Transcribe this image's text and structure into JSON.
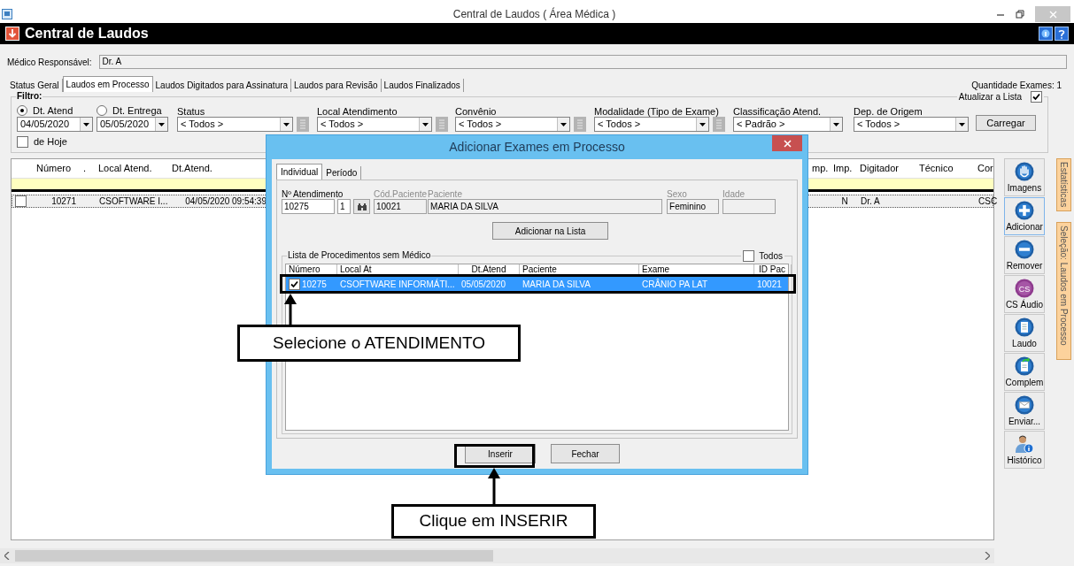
{
  "window": {
    "title": "Central de Laudos ( Área Médica )"
  },
  "app_header": {
    "title": "Central de Laudos"
  },
  "medico": {
    "label": "Médico Responsável:",
    "value": "Dr. A"
  },
  "tabs": [
    {
      "label": "Status Geral",
      "selected": false
    },
    {
      "label": "Laudos em Processo",
      "selected": true
    },
    {
      "label": "Laudos Digitados para Assinatura",
      "selected": false
    },
    {
      "label": "Laudos para Revisão",
      "selected": false
    },
    {
      "label": "Laudos Finalizados",
      "selected": false
    }
  ],
  "quantidade": "Quantidade Exames: 1",
  "filter": {
    "title": "Filtro:",
    "atualizar": {
      "label": "Atualizar a Lista",
      "checked": true
    },
    "date_modes": [
      {
        "label": "Dt. Atend",
        "selected": true,
        "value": "04/05/2020"
      },
      {
        "label": "Dt. Entrega",
        "selected": false,
        "value": "05/05/2020"
      }
    ],
    "de_hoje": {
      "label": "de Hoje",
      "checked": false
    },
    "dropdowns": [
      {
        "label": "Status",
        "value": "< Todos >",
        "lookup": true
      },
      {
        "label": "Local Atendimento",
        "value": "< Todos >",
        "lookup": true
      },
      {
        "label": "Convênio",
        "value": "< Todos >",
        "lookup": true
      },
      {
        "label": "Modalidade (Tipo de Exame)",
        "value": "< Todos >",
        "lookup": true
      },
      {
        "label": "Classificação Atend.",
        "value": "< Padrão >",
        "lookup": false
      },
      {
        "label": "Dep. de Origem",
        "value": "< Todos >",
        "lookup": false
      }
    ],
    "carregar": "Carregar"
  },
  "table": {
    "columns": [
      "Número",
      ".",
      "Local Atend.",
      "Dt.Atend.",
      "mp.",
      "Imp.",
      "Digitador",
      "Técnico",
      "Cor"
    ],
    "rows": [
      {
        "checked": false,
        "cells": [
          "10271",
          null,
          "CSOFTWARE I...",
          "04/05/2020 09:54:39",
          null,
          "N",
          "Dr. A",
          null,
          "CSC"
        ]
      }
    ]
  },
  "side_buttons": [
    {
      "label": "Imagens",
      "kind": "hand",
      "selected": false
    },
    {
      "label": "Adicionar",
      "kind": "plus",
      "selected": true
    },
    {
      "label": "Remover",
      "kind": "minus",
      "selected": false
    },
    {
      "label": "CS Áudio",
      "kind": "cs",
      "icon_text": "CS",
      "selected": false
    },
    {
      "label": "Laudo",
      "kind": "document",
      "selected": false
    },
    {
      "label": "Complem",
      "kind": "document-arrow",
      "selected": false
    },
    {
      "label": "Enviar...",
      "kind": "mail",
      "selected": false
    },
    {
      "label": "Histórico",
      "kind": "person",
      "selected": false
    }
  ],
  "vertical_tabs": [
    "Estatísticas",
    "Seleção: Laudos em Processo"
  ],
  "dialog": {
    "title": "Adicionar Exames em Processo",
    "tabs": [
      {
        "label": "Individual",
        "selected": true
      },
      {
        "label": "Período",
        "selected": false
      }
    ],
    "atendimento": {
      "label": "Nº Atendimento",
      "value": "10275",
      "seq": "1"
    },
    "cod_paciente": {
      "label": "Cód.Paciente",
      "value": "10021"
    },
    "paciente": {
      "label": "Paciente",
      "value": "MARIA DA SILVA"
    },
    "sexo": {
      "label": "Sexo",
      "value": "Feminino"
    },
    "idade": {
      "label": "Idade"
    },
    "add_button": "Adicionar na Lista",
    "list_title": "Lista de Procedimentos sem Médico",
    "todos": {
      "label": "Todos",
      "checked": false
    },
    "columns": [
      "Número",
      "Local At",
      "Dt.Atend",
      "Paciente",
      "Exame",
      "ID Pac"
    ],
    "rows": [
      {
        "checked": true,
        "selected": true,
        "cells": [
          "10275",
          "CSOFTWARE INFORMÁTI...",
          "05/05/2020",
          "MARIA DA SILVA",
          "CRÂNIO PA LAT",
          "10021"
        ]
      }
    ],
    "buttons": [
      "Inserir",
      "Fechar"
    ]
  },
  "annotations": [
    "Selecione o ATENDIMENTO",
    "Clique em INSERIR"
  ]
}
